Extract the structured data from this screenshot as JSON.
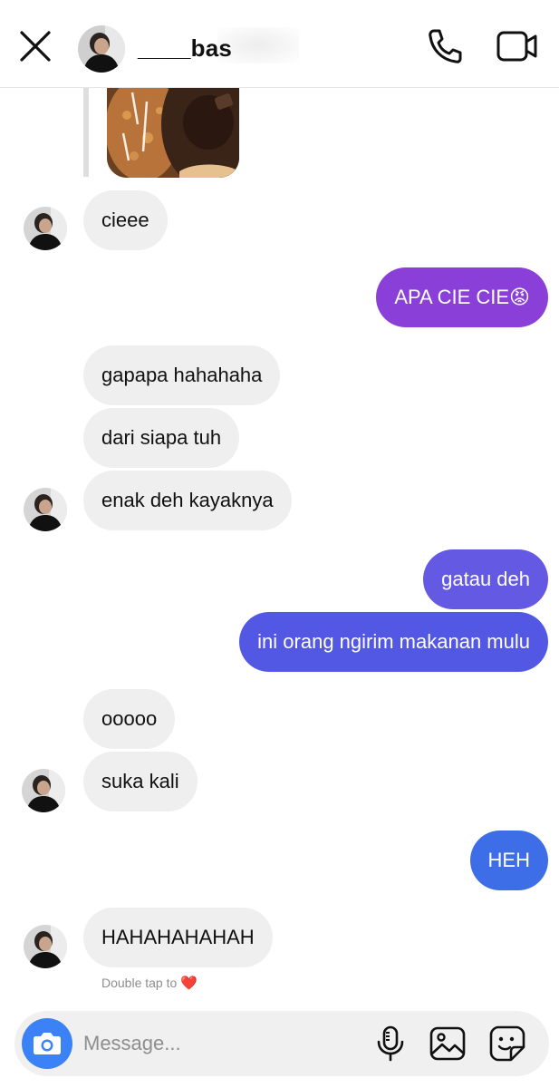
{
  "header": {
    "contact_name": "____bas",
    "icons": {
      "close": "close-icon",
      "call": "phone-icon",
      "video": "video-call-icon"
    }
  },
  "messages": [
    {
      "id": "m1",
      "side": "in",
      "text": "cieee"
    },
    {
      "id": "m2",
      "side": "out",
      "text": "APA CIE CIE😡"
    },
    {
      "id": "m3",
      "side": "in",
      "text": "gapapa hahahaha"
    },
    {
      "id": "m4",
      "side": "in",
      "text": "dari siapa tuh"
    },
    {
      "id": "m5",
      "side": "in",
      "text": "enak deh kayaknya"
    },
    {
      "id": "m6",
      "side": "out",
      "text": "gatau deh"
    },
    {
      "id": "m7",
      "side": "out",
      "text": "ini orang ngirim makanan mulu"
    },
    {
      "id": "m8",
      "side": "in",
      "text": "ooooo"
    },
    {
      "id": "m9",
      "side": "in",
      "text": "suka kali"
    },
    {
      "id": "m10",
      "side": "out",
      "text": "HEH"
    },
    {
      "id": "m11",
      "side": "in",
      "text": "HAHAHAHAHAH"
    }
  ],
  "hint": {
    "text": "Double tap to",
    "heart": "❤️"
  },
  "composer": {
    "placeholder": "Message...",
    "icons": {
      "camera": "camera-icon",
      "mic": "microphone-icon",
      "gallery": "gallery-icon",
      "sticker": "sticker-icon"
    }
  },
  "colors": {
    "bubble_in": "#efefef",
    "bubble_out_purple": "#8b3fd9",
    "bubble_out_indigo": "#5a59e6",
    "bubble_out_blue": "#3d6ee8",
    "camera_button": "#3b82f6"
  }
}
